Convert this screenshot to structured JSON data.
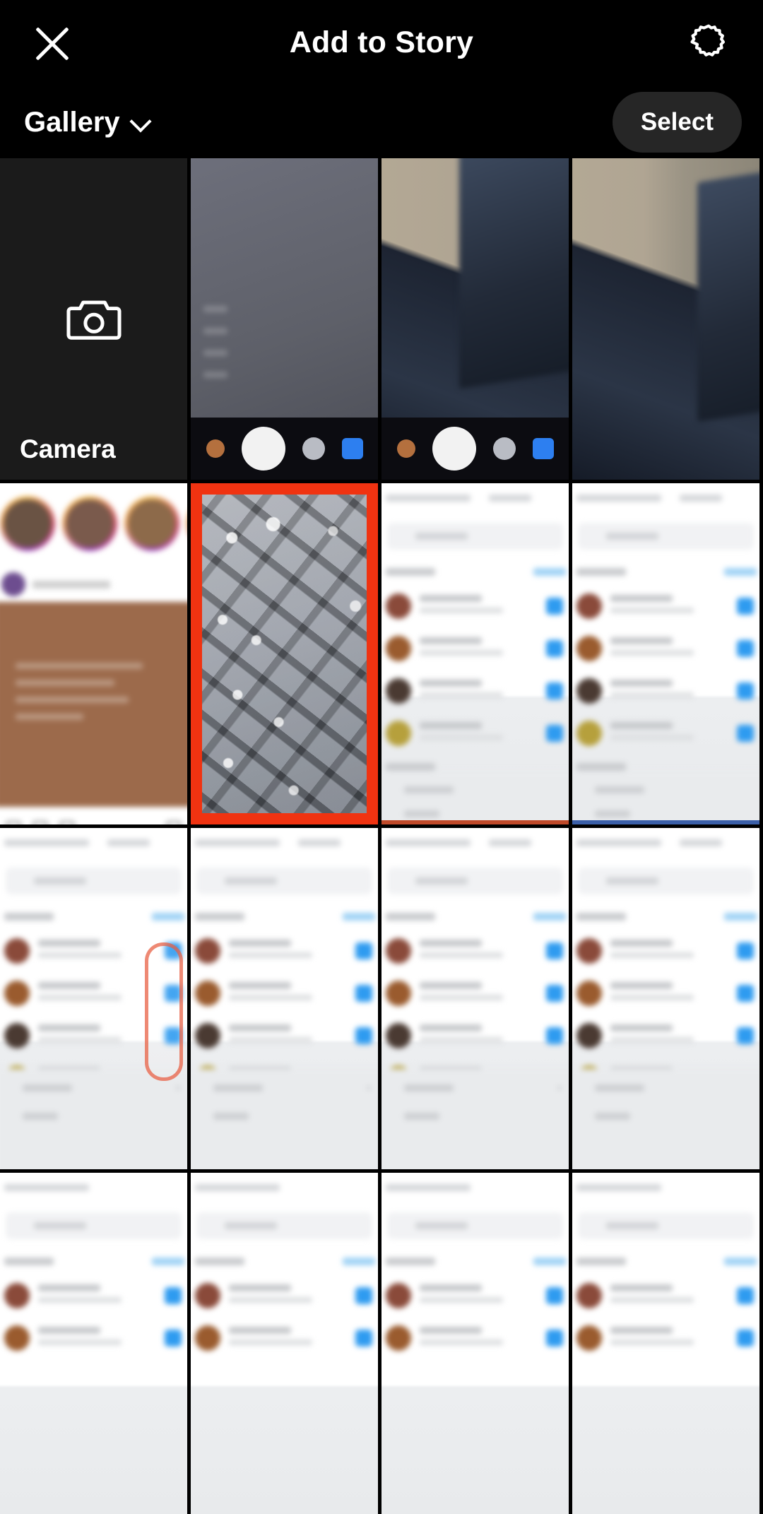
{
  "header": {
    "title": "Add to Story",
    "close_icon": "close-icon",
    "settings_icon": "gear-icon"
  },
  "gallery_bar": {
    "source_label": "Gallery",
    "chevron_icon": "chevron-down-icon",
    "select_label": "Select"
  },
  "camera_tile": {
    "label": "Camera",
    "icon": "camera-icon"
  },
  "colors": {
    "background": "#000000",
    "selection_highlight": "#F03311",
    "select_button": "#262626",
    "camera_tile": "#1b1b1b",
    "text": "#ffffff"
  },
  "grid": {
    "columns": 4,
    "rows": 4,
    "selected_index": 6,
    "items": [
      {
        "name": "camera-tile",
        "kind": "camera",
        "selected": false
      },
      {
        "name": "thumbnail-1",
        "kind": "phone-ui",
        "selected": false
      },
      {
        "name": "thumbnail-2",
        "kind": "desk-photo",
        "selected": false
      },
      {
        "name": "thumbnail-3",
        "kind": "desk-photo",
        "selected": false
      },
      {
        "name": "thumbnail-4",
        "kind": "ig-feed",
        "selected": false
      },
      {
        "name": "thumbnail-5",
        "kind": "keyboard",
        "selected": true
      },
      {
        "name": "thumbnail-6",
        "kind": "list-ui",
        "selected": false
      },
      {
        "name": "thumbnail-7",
        "kind": "list-ui",
        "selected": false
      },
      {
        "name": "thumbnail-8",
        "kind": "list-ui",
        "selected": false
      },
      {
        "name": "thumbnail-9",
        "kind": "list-ui",
        "selected": false
      },
      {
        "name": "thumbnail-10",
        "kind": "list-ui",
        "selected": false
      },
      {
        "name": "thumbnail-11",
        "kind": "list-ui",
        "selected": false
      },
      {
        "name": "thumbnail-12",
        "kind": "list-ui",
        "selected": false
      },
      {
        "name": "thumbnail-13",
        "kind": "list-ui",
        "selected": false
      },
      {
        "name": "thumbnail-14",
        "kind": "list-ui",
        "selected": false
      },
      {
        "name": "thumbnail-15",
        "kind": "list-ui",
        "selected": false
      }
    ]
  }
}
